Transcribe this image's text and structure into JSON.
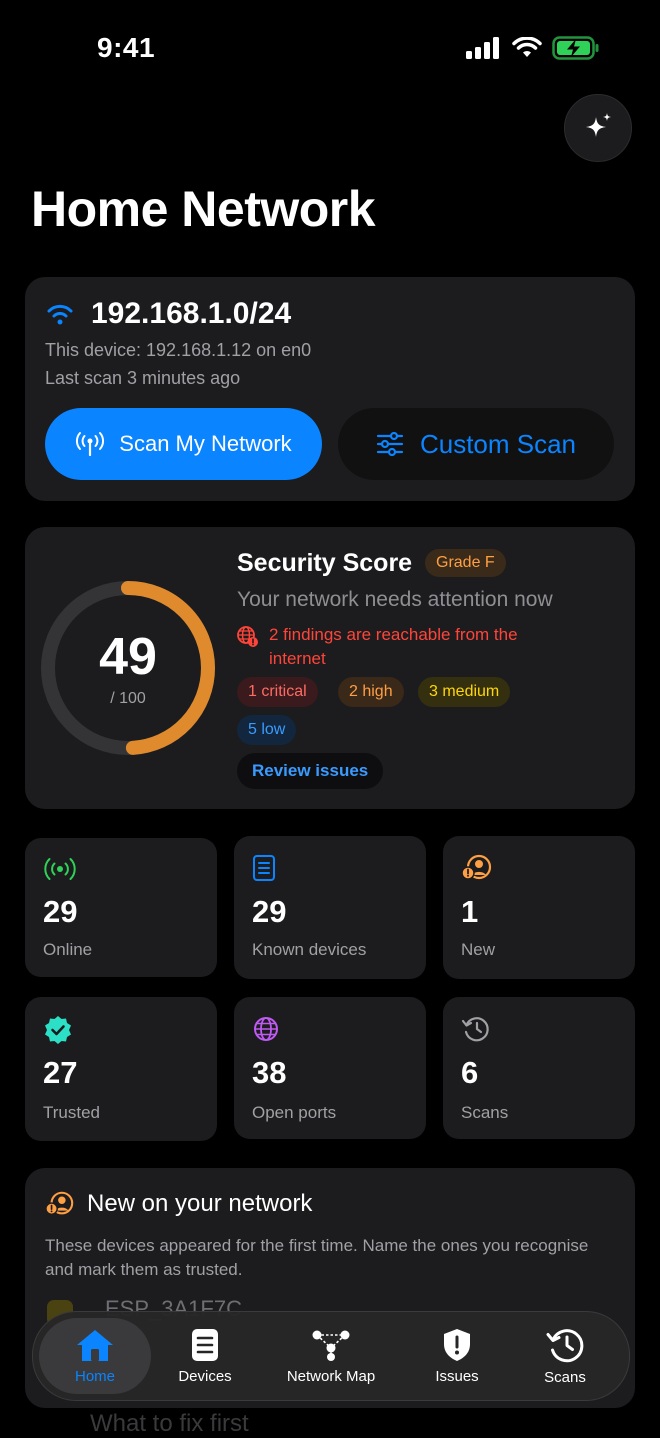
{
  "status_bar": {
    "time": "9:41"
  },
  "header": {
    "title": "Home Network"
  },
  "network": {
    "subnet": "192.168.1.0/24",
    "device_line": "This device: 192.168.1.12 on en0",
    "last_scan": "Last scan 3 minutes ago",
    "scan_label": "Scan My Network",
    "custom_label": "Custom Scan"
  },
  "security": {
    "title": "Security Score",
    "grade": "Grade F",
    "score": "49",
    "score_max": "/ 100",
    "score_fraction": 0.49,
    "subtitle": "Your network needs attention now",
    "reachable": "2 findings are reachable from the internet",
    "pills": {
      "critical": "1 critical",
      "high": "2 high",
      "medium": "3 medium",
      "low": "5 low"
    },
    "review_label": "Review issues"
  },
  "stats": [
    {
      "value": "29",
      "label": "Online",
      "icon": "broadcast-icon",
      "color": "#30d158"
    },
    {
      "value": "29",
      "label": "Known devices",
      "icon": "list-icon",
      "color": "#0a84ff"
    },
    {
      "value": "1",
      "label": "New",
      "icon": "new-person-icon",
      "color": "#ff9f43"
    },
    {
      "value": "27",
      "label": "Trusted",
      "icon": "verified-badge-icon",
      "color": "#2ce0c8"
    },
    {
      "value": "38",
      "label": "Open ports",
      "icon": "globe-icon",
      "color": "#bf5af2"
    },
    {
      "value": "6",
      "label": "Scans",
      "icon": "history-icon",
      "color": "#a0a0a5"
    }
  ],
  "new_section": {
    "title": "New on your network",
    "description": "These devices appeared for the first time. Name the ones you recognise and mark them as trusted.",
    "partial_device": "ESP_3A1F7C"
  },
  "next_section": {
    "title": "What to fix first"
  },
  "tabs": [
    {
      "label": "Home",
      "icon": "home-icon"
    },
    {
      "label": "Devices",
      "icon": "devices-icon"
    },
    {
      "label": "Network Map",
      "icon": "network-map-icon"
    },
    {
      "label": "Issues",
      "icon": "issues-shield-icon"
    },
    {
      "label": "Scans",
      "icon": "scans-history-icon"
    }
  ],
  "colors": {
    "accent": "#0a84ff",
    "background": "#000000",
    "card": "#1c1c1e",
    "gauge": "#e08a2e"
  }
}
